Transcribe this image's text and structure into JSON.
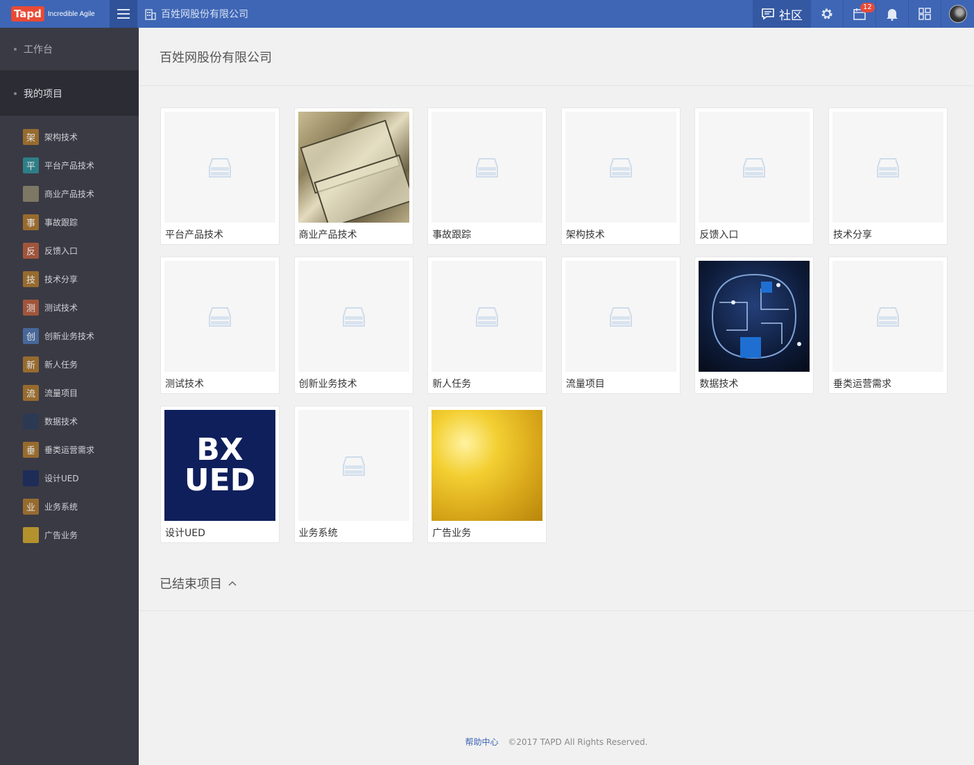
{
  "header": {
    "logo_text": "Tapd",
    "logo_tagline": "Incredible Agile",
    "company": "百姓网股份有限公司",
    "community_label": "社区",
    "notification_count": "12",
    "icons": [
      "menu-icon",
      "building-icon",
      "chat-icon",
      "gear-icon",
      "calendar-icon",
      "bell-icon",
      "grid-icon",
      "avatar"
    ]
  },
  "sidebar": {
    "workbench": "工作台",
    "my_projects": "我的项目",
    "items": [
      {
        "label": "架构技术",
        "icon": "架",
        "color": "#a8742a"
      },
      {
        "label": "平台产品技术",
        "icon": "平",
        "color": "#2d8a92"
      },
      {
        "label": "商业产品技术",
        "icon": "",
        "color": "#8a846a"
      },
      {
        "label": "事故跟踪",
        "icon": "事",
        "color": "#a8742a"
      },
      {
        "label": "反馈入口",
        "icon": "反",
        "color": "#b25a3a"
      },
      {
        "label": "技术分享",
        "icon": "技",
        "color": "#a8742a"
      },
      {
        "label": "测试技术",
        "icon": "测",
        "color": "#b25a3a"
      },
      {
        "label": "创新业务技术",
        "icon": "创",
        "color": "#4a6fa8"
      },
      {
        "label": "新人任务",
        "icon": "新",
        "color": "#a8742a"
      },
      {
        "label": "流量项目",
        "icon": "流",
        "color": "#a8742a"
      },
      {
        "label": "数据技术",
        "icon": "",
        "color": "#2a3a55"
      },
      {
        "label": "垂类运营需求",
        "icon": "垂",
        "color": "#a8742a"
      },
      {
        "label": "设计UED",
        "icon": "",
        "color": "#1a2a5c"
      },
      {
        "label": "业务系统",
        "icon": "业",
        "color": "#a8742a"
      },
      {
        "label": "广告业务",
        "icon": "",
        "color": "#c9a22a"
      }
    ]
  },
  "main": {
    "title": "百姓网股份有限公司",
    "projects": [
      {
        "name": "平台产品技术",
        "image": "placeholder"
      },
      {
        "name": "商业产品技术",
        "image": "money"
      },
      {
        "name": "事故跟踪",
        "image": "placeholder"
      },
      {
        "name": "架构技术",
        "image": "placeholder"
      },
      {
        "name": "反馈入口",
        "image": "placeholder"
      },
      {
        "name": "技术分享",
        "image": "placeholder"
      },
      {
        "name": "测试技术",
        "image": "placeholder"
      },
      {
        "name": "创新业务技术",
        "image": "placeholder"
      },
      {
        "name": "新人任务",
        "image": "placeholder"
      },
      {
        "name": "流量项目",
        "image": "placeholder"
      },
      {
        "name": "数据技术",
        "image": "brain"
      },
      {
        "name": "垂类运营需求",
        "image": "placeholder"
      },
      {
        "name": "设计UED",
        "image": "ued"
      },
      {
        "name": "业务系统",
        "image": "placeholder"
      },
      {
        "name": "广告业务",
        "image": "gold"
      }
    ],
    "ued_logo_text": [
      "BX",
      "UED"
    ],
    "ended_projects_label": "已结束项目"
  },
  "footer": {
    "help_link": "帮助中心",
    "copyright": "©2017 TAPD All Rights Reserved."
  }
}
